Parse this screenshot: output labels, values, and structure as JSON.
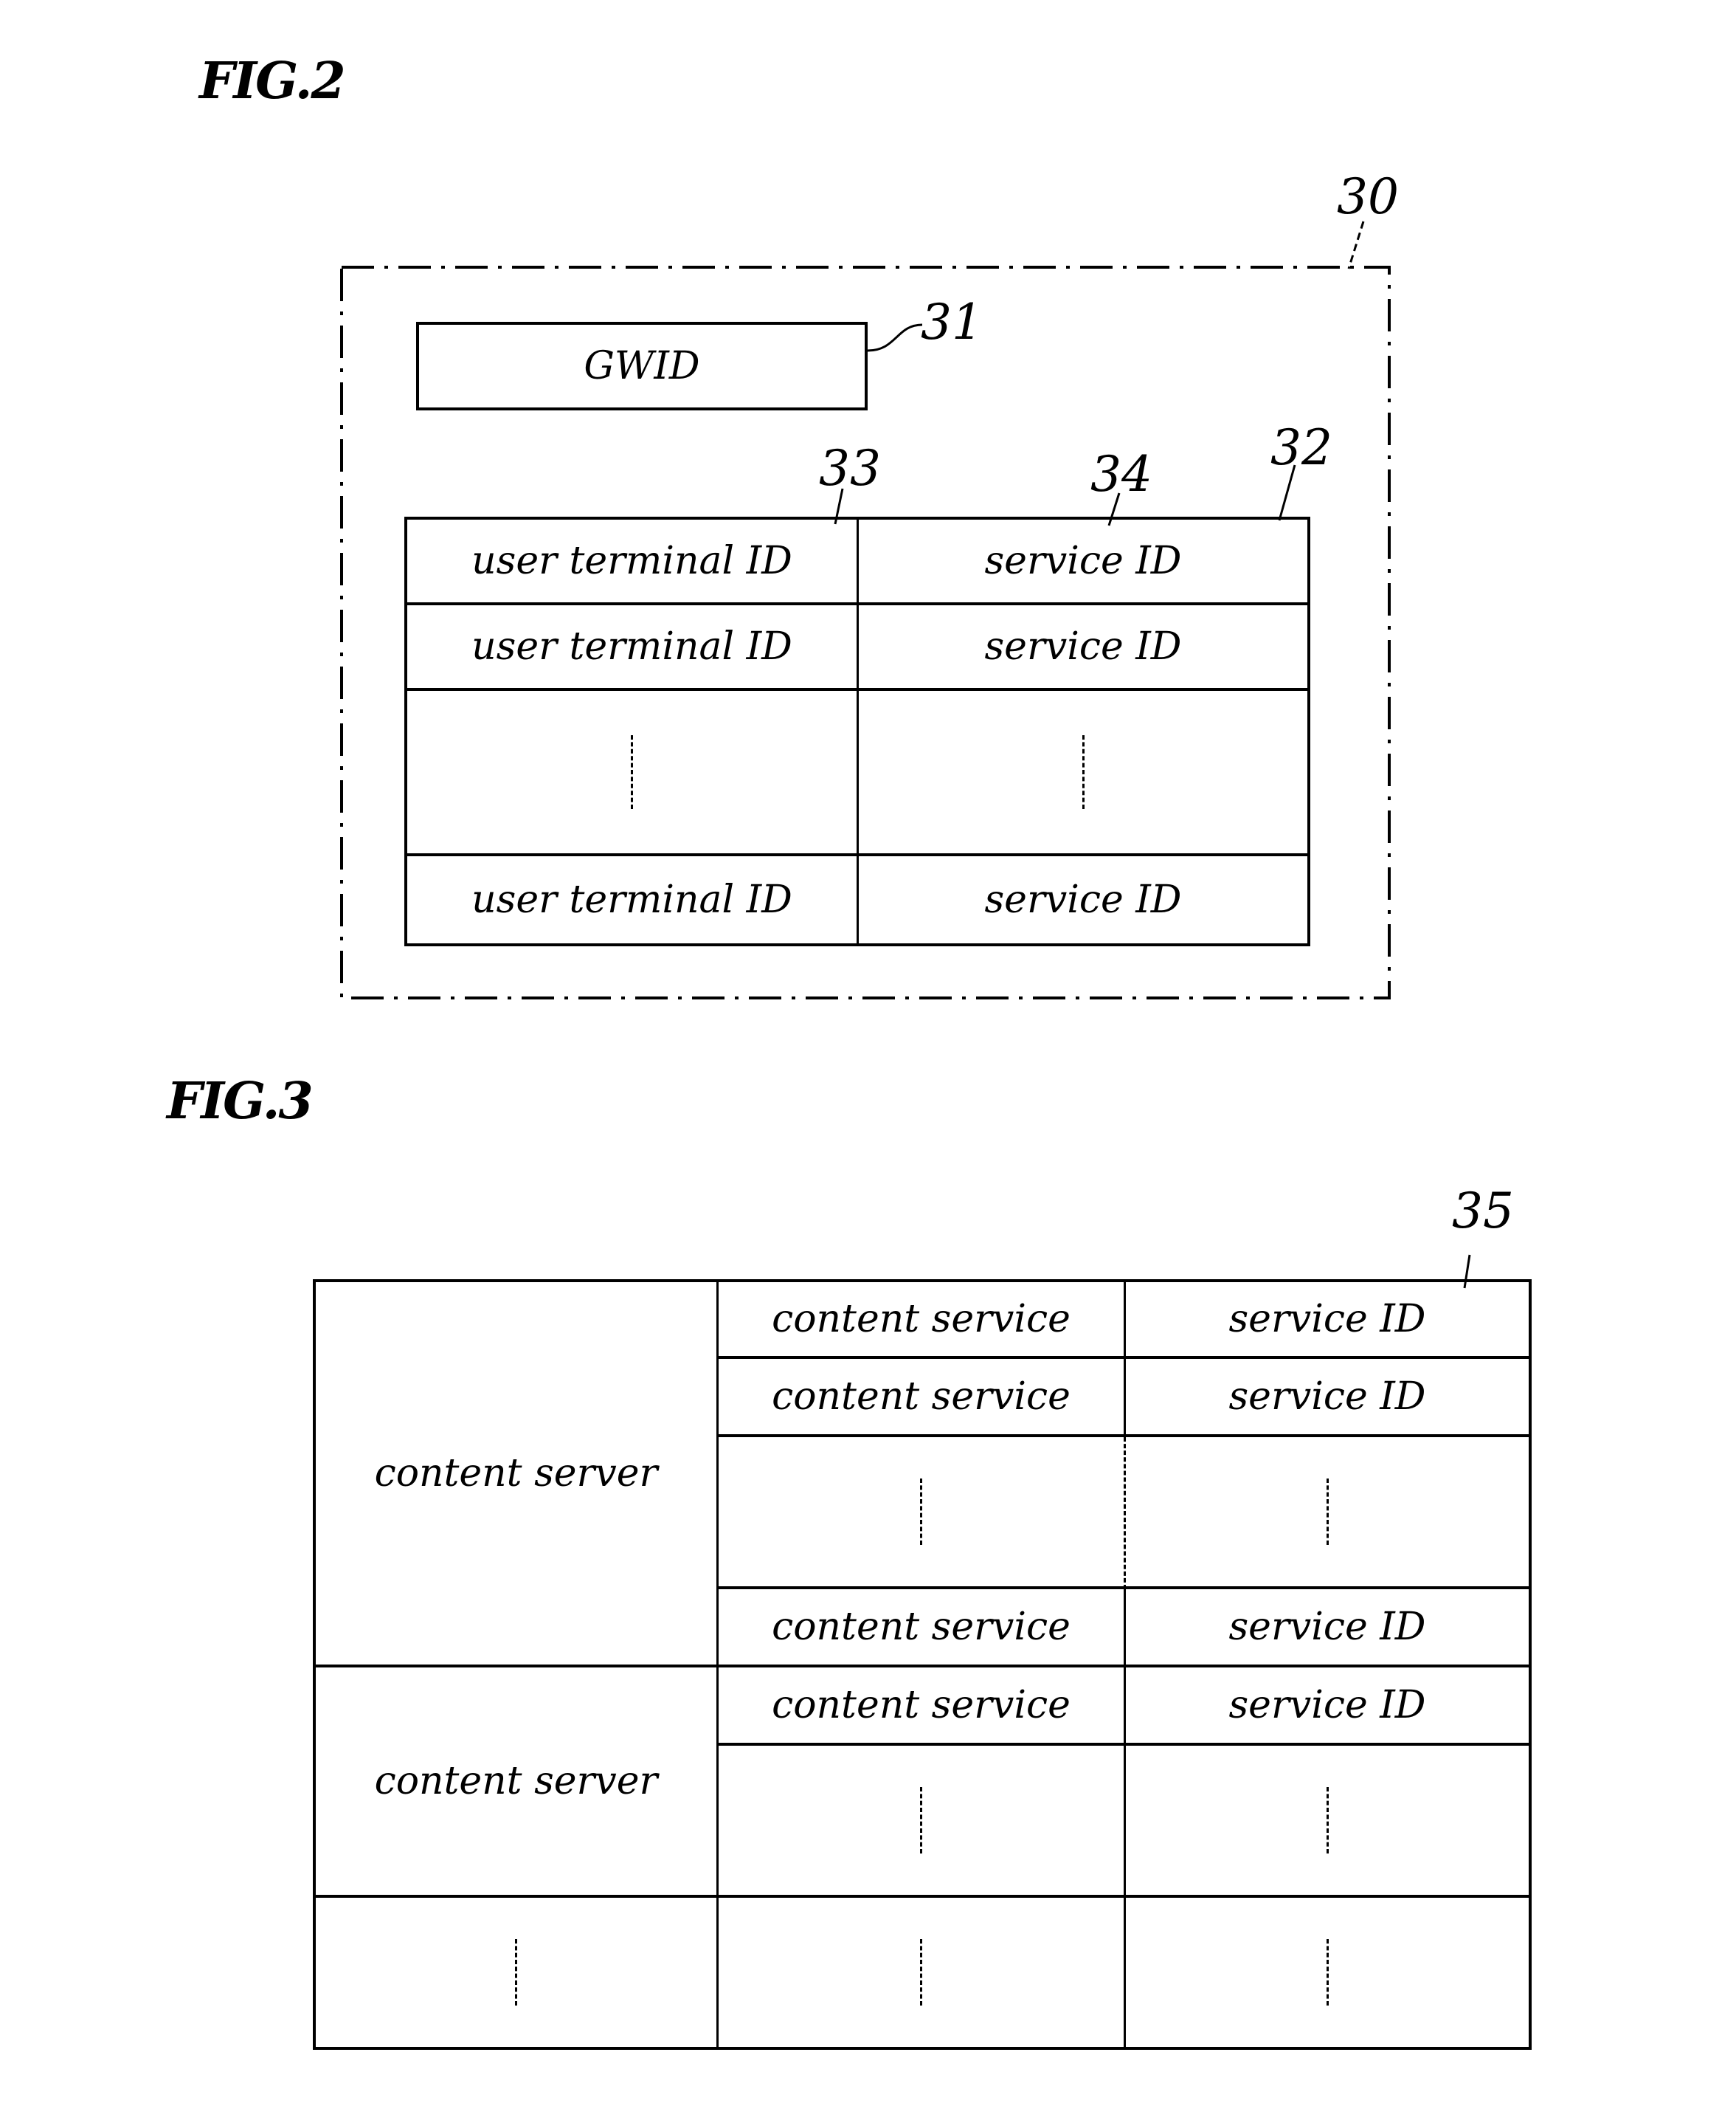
{
  "fig2": {
    "title": "FIG.2",
    "refs": {
      "outer": "30",
      "gwid": "31",
      "table": "32",
      "col1": "33",
      "col2": "34"
    },
    "gwid_label": "GWID",
    "table_rows": [
      {
        "col1": "user terminal ID",
        "col2": "service ID"
      },
      {
        "col1": "user terminal ID",
        "col2": "service ID"
      },
      {
        "col1": "⋮",
        "col2": "⋮",
        "ellipsis": true
      },
      {
        "col1": "user terminal ID",
        "col2": "service ID"
      }
    ]
  },
  "fig3": {
    "title": "FIG.3",
    "refs": {
      "table": "35"
    },
    "groups": [
      {
        "server": "content server",
        "rows": [
          {
            "service": "content service",
            "id": "service ID"
          },
          {
            "service": "content service",
            "id": "service ID"
          },
          {
            "service": "⋮",
            "id": "⋮",
            "ellipsis": true
          },
          {
            "service": "content service",
            "id": "service ID"
          }
        ]
      },
      {
        "server": "content server",
        "rows": [
          {
            "service": "content service",
            "id": "service ID"
          },
          {
            "service": "⋮",
            "id": "⋮",
            "ellipsis": true
          }
        ]
      },
      {
        "server": "⋮",
        "ellipsis": true,
        "rows": [
          {
            "service": "⋮",
            "id": "⋮",
            "ellipsis": true
          }
        ]
      }
    ]
  }
}
